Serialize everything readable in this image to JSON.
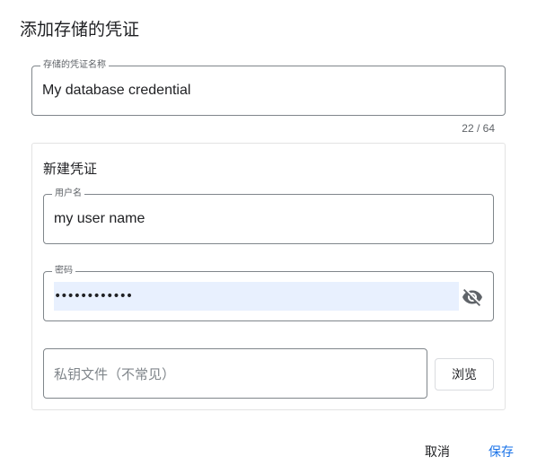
{
  "dialog": {
    "title": "添加存储的凭证"
  },
  "credential_name": {
    "label": "存储的凭证名称",
    "value": "My database credential",
    "counter": "22 / 64"
  },
  "new_credential": {
    "title": "新建凭证",
    "username": {
      "label": "用户名",
      "value": "my user name"
    },
    "password": {
      "label": "密码",
      "masked_value": "••••••••••••",
      "toggle_icon": "eye-off-icon"
    },
    "key_file": {
      "placeholder": "私钥文件（不常见）"
    },
    "browse_label": "浏览"
  },
  "actions": {
    "cancel_label": "取消",
    "save_label": "保存"
  },
  "colors": {
    "accent": "#1a73e8",
    "autofill_bg": "#e8f0fe",
    "border": "#80868b"
  }
}
